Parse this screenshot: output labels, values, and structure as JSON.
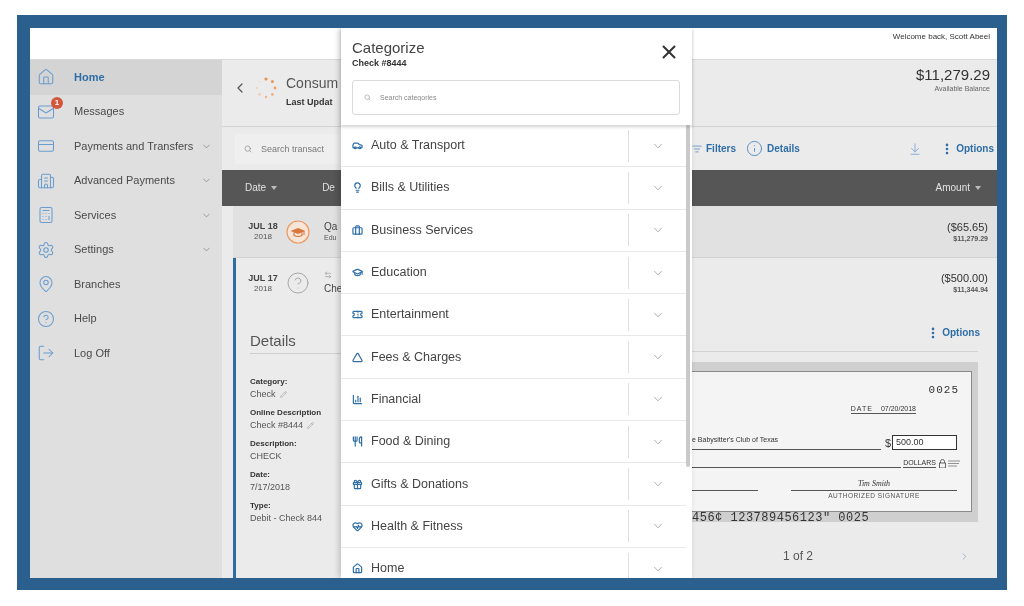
{
  "header": {
    "welcome": "Welcome back, Scott Abeel"
  },
  "sidebar": {
    "items": [
      {
        "label": "Home",
        "kind": "link",
        "selected": true
      },
      {
        "label": "Messages",
        "kind": "link",
        "selected": false,
        "badge": "1"
      },
      {
        "label": "Payments and Transfers",
        "kind": "group",
        "selected": false
      },
      {
        "label": "Advanced Payments",
        "kind": "group",
        "selected": false
      },
      {
        "label": "Services",
        "kind": "group",
        "selected": false
      },
      {
        "label": "Settings",
        "kind": "group",
        "selected": false
      },
      {
        "label": "Branches",
        "kind": "link",
        "selected": false
      },
      {
        "label": "Help",
        "kind": "link",
        "selected": false
      },
      {
        "label": "Log Off",
        "kind": "link",
        "selected": false
      }
    ]
  },
  "account": {
    "title": "Consum",
    "last_updated": "Last Updat",
    "balance": "$11,279.29",
    "balance_label": "Available Balance"
  },
  "toolbar": {
    "search": {
      "placeholder": "Search transact"
    },
    "filters": "Filters",
    "details": "Details",
    "options": "Options"
  },
  "transactions": {
    "columns": [
      {
        "label": "Date",
        "sortable": true
      },
      {
        "label": "De",
        "sortable": false
      },
      {
        "label": "Amount",
        "sortable": true
      }
    ],
    "rows": [
      {
        "kind": "purchase",
        "date": "JUL 18",
        "year": "2018",
        "title": "Qa",
        "subtitle": "Edu",
        "amount": "($65.65)",
        "balance": "$11,279.29",
        "expanded": false
      },
      {
        "kind": "check",
        "date": "JUL 17",
        "year": "2018",
        "title": "Che",
        "amount": "($500.00)",
        "balance": "$11,344.94",
        "expanded": true
      }
    ]
  },
  "details": {
    "title": "Details",
    "options": "Options",
    "fields": [
      {
        "label": "Category:",
        "value": "Check",
        "editable": true
      },
      {
        "label": "Online Description",
        "value": "Check #8444",
        "editable": true
      },
      {
        "label": "Description:",
        "value": "CHECK",
        "editable": false
      },
      {
        "label": "Date:",
        "value": "7/17/2018",
        "editable": false
      },
      {
        "label": "Type:",
        "value": "Debit - Check 844",
        "editable": false
      }
    ],
    "check_image": {
      "number": "0025",
      "date_label": "DATE",
      "date": "07/20/2018",
      "payee": "e Babysitter's Club of Texas",
      "currency": "$",
      "amount": "500.00",
      "amount_words": "DOLLARS",
      "signature": "Tim Smith",
      "signature_label": "AUTHORIZED SIGNATURE",
      "micr": "456¢ 123789456123\" 0025"
    },
    "pager": "1 of 2"
  },
  "modal": {
    "title": "Categorize",
    "subtitle": "Check #8444",
    "search": {
      "placeholder": "Search categories"
    },
    "categories": [
      {
        "label": "Auto & Transport",
        "expanded": false
      },
      {
        "label": "Bills & Utilities",
        "expanded": false
      },
      {
        "label": "Business Services",
        "expanded": false
      },
      {
        "label": "Education",
        "expanded": false
      },
      {
        "label": "Entertainment",
        "expanded": false
      },
      {
        "label": "Fees & Charges",
        "expanded": false
      },
      {
        "label": "Financial",
        "expanded": false
      },
      {
        "label": "Food & Dining",
        "expanded": false
      },
      {
        "label": "Gifts & Donations",
        "expanded": false
      },
      {
        "label": "Health & Fitness",
        "expanded": false
      },
      {
        "label": "Home",
        "expanded": false
      }
    ]
  }
}
